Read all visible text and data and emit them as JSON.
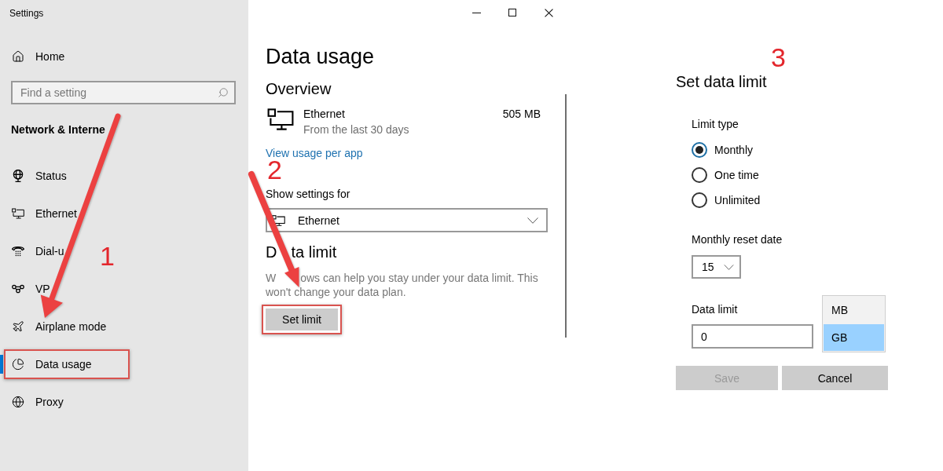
{
  "window": {
    "title": "Settings"
  },
  "sidebar": {
    "home": "Home",
    "search": {
      "placeholder": "Find a setting"
    },
    "section_title": "Network & Interne",
    "items": [
      {
        "label": "Status",
        "selected": false,
        "highlighted": false
      },
      {
        "label": "Ethernet",
        "selected": false,
        "highlighted": false
      },
      {
        "label": "Dial-u",
        "selected": false,
        "highlighted": false
      },
      {
        "label": "VP",
        "selected": false,
        "highlighted": false
      },
      {
        "label": "Airplane mode",
        "selected": false,
        "highlighted": false
      },
      {
        "label": "Data usage",
        "selected": true,
        "highlighted": true
      },
      {
        "label": "Proxy",
        "selected": false,
        "highlighted": false
      }
    ],
    "step_label": "1"
  },
  "content": {
    "title": "Data usage",
    "overview": {
      "heading": "Overview",
      "network": "Ethernet",
      "period": "From the last 30 days",
      "usage": "505 MB",
      "link": "View usage per app"
    },
    "step_label": "2",
    "show_settings": {
      "label": "Show settings for",
      "value": "Ethernet"
    },
    "data_limit": {
      "heading": [
        "D",
        "ta limit"
      ],
      "description_lines": [
        [
          "W",
          "ows can help you stay under your data limit. This"
        ],
        [
          "won't change your data plan."
        ]
      ],
      "button": {
        "label": "Set limit",
        "highlighted": true
      }
    }
  },
  "dialog": {
    "step_label": "3",
    "title": "Set data limit",
    "limit_type": {
      "label": "Limit type",
      "options": [
        {
          "label": "Monthly",
          "selected": true
        },
        {
          "label": "One time",
          "selected": false
        },
        {
          "label": "Unlimited",
          "selected": false
        }
      ]
    },
    "reset_date": {
      "label": "Monthly reset date",
      "value": "15"
    },
    "data_limit": {
      "label": "Data limit",
      "value": "0",
      "units": [
        {
          "label": "MB",
          "selected": false
        },
        {
          "label": "GB",
          "selected": true
        }
      ]
    },
    "buttons": [
      {
        "label": "Save",
        "disabled": true
      },
      {
        "label": "Cancel",
        "disabled": false
      }
    ]
  }
}
